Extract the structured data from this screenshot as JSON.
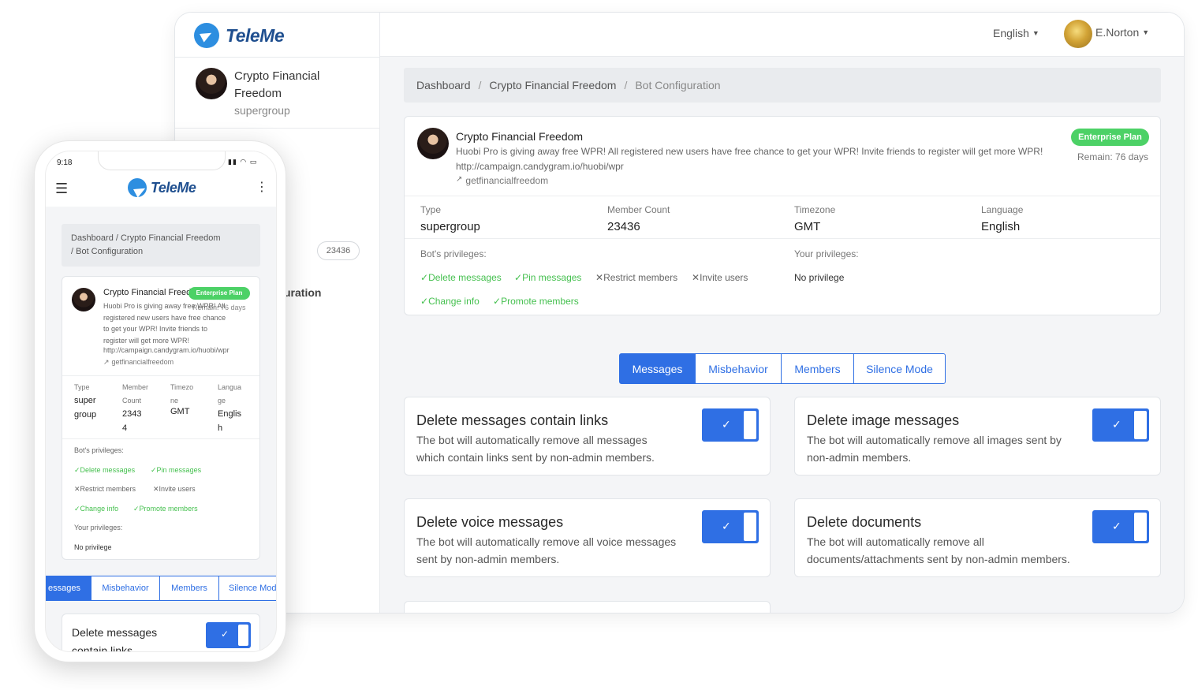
{
  "app": {
    "logo_text": "TeleMe"
  },
  "header": {
    "language": "English",
    "user_name": "E.Norton"
  },
  "sidebar": {
    "group_name_line1": "Crypto Financial",
    "group_name_line2": "Freedom",
    "group_type": "supergroup",
    "member_count_badge": "23436",
    "partial_label": "uration"
  },
  "breadcrumb": {
    "items": [
      "Dashboard",
      "Crypto Financial Freedom",
      "Bot Configuration"
    ],
    "separator": "/"
  },
  "group": {
    "name": "Crypto Financial Freedom",
    "description": "Huobi Pro is giving away free WPR! All registered new users have free chance to get your WPR! Invite friends to register will get more WPR!",
    "link": "http://campaign.candygram.io/huobi/wpr",
    "handle": "getfinancialfreedom",
    "plan": "Enterprise Plan",
    "remain": "Remain: 76 days"
  },
  "stats": {
    "type_label": "Type",
    "type_value": "supergroup",
    "member_label": "Member Count",
    "member_value": "23436",
    "tz_label": "Timezone",
    "tz_value": "GMT",
    "lang_label": "Language",
    "lang_value": "English"
  },
  "privileges": {
    "bot_label": "Bot's privileges:",
    "your_label": "Your privileges:",
    "your_value": "No privilege",
    "items": [
      {
        "label": "Delete messages",
        "granted": true
      },
      {
        "label": "Pin messages",
        "granted": true
      },
      {
        "label": "Restrict members",
        "granted": false
      },
      {
        "label": "Invite users",
        "granted": false
      },
      {
        "label": "Change info",
        "granted": true
      },
      {
        "label": "Promote members",
        "granted": true
      }
    ]
  },
  "tabs": [
    {
      "label": "Messages",
      "active": true
    },
    {
      "label": "Misbehavior",
      "active": false
    },
    {
      "label": "Members",
      "active": false
    },
    {
      "label": "Silence Mode",
      "active": false
    }
  ],
  "settings": [
    {
      "title": "Delete messages contain links",
      "desc_line1": "The bot will automatically remove all messages",
      "desc_line2": "which contain links sent by non-admin members.",
      "enabled": true
    },
    {
      "title": "Delete image messages",
      "desc_line1": "The bot will automatically remove all images sent by",
      "desc_line2": "non-admin members.",
      "enabled": true
    },
    {
      "title": "Delete voice messages",
      "desc_line1": "The bot will automatically remove all voice messages",
      "desc_line2": "sent by non-admin members.",
      "enabled": true
    },
    {
      "title": "Delete documents",
      "desc_line1": "The bot will automatically remove all",
      "desc_line2": "documents/attachments sent by non-admin members.",
      "enabled": true
    }
  ],
  "phone": {
    "time": "9:18",
    "breadcrumb_line1": "Dashboard  /  Crypto Financial Freedom",
    "breadcrumb_line2": "/  Bot Configuration",
    "plan": "Enterprise Plan",
    "remain": "Remain: 76 days",
    "desc_lines": [
      "Huobi Pro is giving away free WPR! All",
      "registered new users have free chance",
      "to get your WPR! Invite friends to",
      "register will get more WPR!"
    ],
    "stat_labels": [
      [
        "Type",
        ""
      ],
      [
        "Member",
        "Count"
      ],
      [
        "Timezo",
        "ne"
      ],
      [
        "Langua",
        "ge"
      ]
    ],
    "stat_values": [
      [
        "super",
        "group"
      ],
      [
        "2343",
        "4"
      ],
      [
        "GMT",
        ""
      ],
      [
        "Englis",
        "h"
      ]
    ],
    "tab_first": "essages",
    "tab_last": "Silence Mod",
    "setting_line1": "Delete messages",
    "setting_line2": "contain links"
  },
  "icons": {
    "check": "check-icon",
    "cross": "cross-icon",
    "link": "external-link-icon",
    "menu": "hamburger-menu-icon",
    "more": "kebab-menu-icon"
  }
}
